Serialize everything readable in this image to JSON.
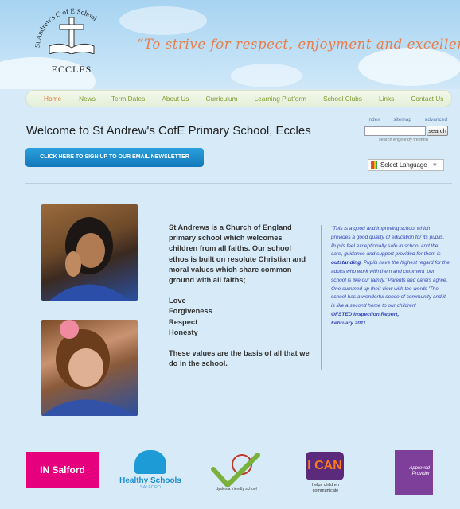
{
  "crest": {
    "arc_text": "St Andrew's C of E School",
    "bottom_text": "ECCLES"
  },
  "motto": "“To strive for respect, enjoyment and excellence”",
  "nav": {
    "items": [
      {
        "label": "Home",
        "active": true
      },
      {
        "label": "News"
      },
      {
        "label": "Term Dates"
      },
      {
        "label": "About Us"
      },
      {
        "label": "Curriculum"
      },
      {
        "label": "Learning Platform"
      },
      {
        "label": "School Clubs"
      },
      {
        "label": "Links"
      },
      {
        "label": "Contact Us"
      }
    ]
  },
  "page_title": "Welcome to St Andrew's CofE Primary School, Eccles",
  "search": {
    "links": [
      "index",
      "sitemap",
      "advanced"
    ],
    "value": "",
    "button_label": "search",
    "engine_text": "search engine by freefind"
  },
  "newsletter_button": "CLICK HERE TO SIGN UP TO OUR EMAIL NEWSLETTER",
  "language": {
    "label": "Select Language",
    "arrow": "▼"
  },
  "mission": {
    "intro": "St Andrews is a Church of England primary school which welcomes children from all faiths.  Our school ethos is built on resolute Christian and moral values which share common ground with all faiths;",
    "values": [
      "Love",
      "Forgiveness",
      "Respect",
      "Honesty"
    ],
    "closing": "These values are the basis of all that we do in the school."
  },
  "quote": {
    "part1": "\"This is a good and improving school which provides a good quality of education for its pupils.  Pupils feel exceptionally safe in school and the care, guidance and support provided for them is ",
    "emphasis": "outstanding",
    "part2": ".  Pupils have the highest regard for the adults who work with them and comment 'our school is like our family.' Parents and carers agree.  One summed up their view with the words 'The school has a wonderful sense of community and it is like a second home to our children'",
    "source_line1": "OFSTED Inspection Report,",
    "source_line2": "February 2011"
  },
  "logos": {
    "in_salford": "IN Salford",
    "healthy_schools": "Healthy Schools",
    "healthy_schools_sub": "SALFORD",
    "dyslexia": "dyslexia friendly school",
    "ican": "I CAN",
    "ican_sub": "helps children communicate",
    "approved": "Approved Provider"
  },
  "colors": {
    "nav_text": "#7c9b2f",
    "nav_active": "#e0762e",
    "motto": "#e97d4a",
    "newsletter_bg": "#1378bb",
    "quote_text": "#3344bb",
    "in_salford_bg": "#e6007e",
    "approved_bg": "#7e3f9a"
  }
}
